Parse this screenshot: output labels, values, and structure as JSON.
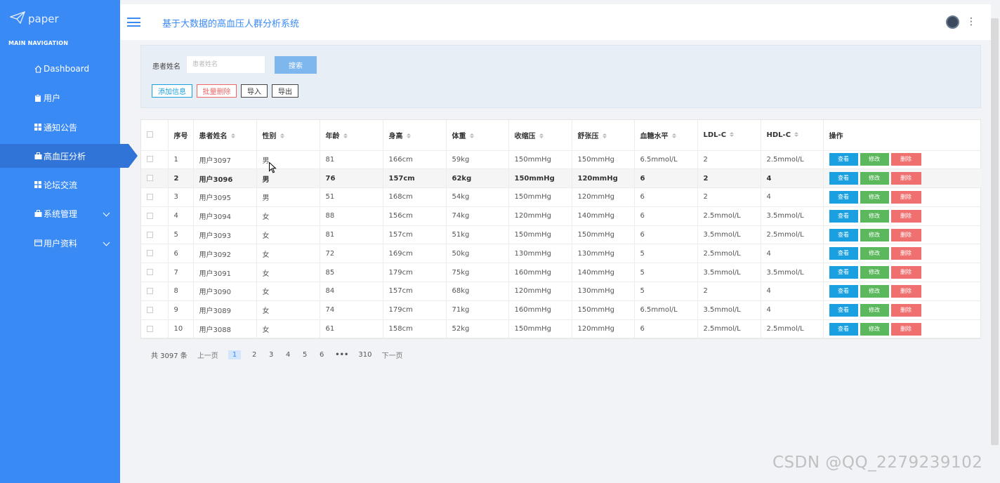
{
  "sidebar": {
    "logo_text": "paper",
    "nav_title": "MAIN NAVIGATION",
    "items": [
      {
        "label": "Dashboard",
        "icon": "home-icon"
      },
      {
        "label": "用户",
        "icon": "clipboard-icon"
      },
      {
        "label": "通知公告",
        "icon": "grid-icon"
      },
      {
        "label": "高血压分析",
        "icon": "briefcase-icon",
        "active": true
      },
      {
        "label": "论坛交流",
        "icon": "grid-icon"
      },
      {
        "label": "系统管理",
        "icon": "briefcase-icon",
        "expandable": true
      },
      {
        "label": "用户资料",
        "icon": "card-icon",
        "expandable": true
      }
    ]
  },
  "header": {
    "title": "基于大数据的高血压人群分析系统"
  },
  "search": {
    "label": "患者姓名",
    "placeholder": "患者姓名",
    "button": "搜索"
  },
  "toolbar": {
    "add": "添加信息",
    "batch_delete": "批量删除",
    "import": "导入",
    "export": "导出"
  },
  "table": {
    "columns": [
      "序号",
      "患者姓名",
      "性别",
      "年龄",
      "身高",
      "体重",
      "收缩压",
      "舒张压",
      "血糖水平",
      "LDL-C",
      "HDL-C",
      "操作"
    ],
    "actions": {
      "view": "查看",
      "edit": "修改",
      "delete": "删除"
    },
    "rows": [
      [
        "1",
        "用户3097",
        "男",
        "81",
        "166cm",
        "59kg",
        "150mmHg",
        "150mmHg",
        "6.5mmol/L",
        "2",
        "2.5mmol/L"
      ],
      [
        "2",
        "用户3096",
        "男",
        "76",
        "157cm",
        "62kg",
        "150mmHg",
        "120mmHg",
        "6",
        "2",
        "4"
      ],
      [
        "3",
        "用户3095",
        "男",
        "51",
        "168cm",
        "54kg",
        "150mmHg",
        "120mmHg",
        "6",
        "2",
        "4"
      ],
      [
        "4",
        "用户3094",
        "女",
        "88",
        "156cm",
        "74kg",
        "120mmHg",
        "140mmHg",
        "6",
        "2.5mmol/L",
        "3.5mmol/L"
      ],
      [
        "5",
        "用户3093",
        "女",
        "81",
        "157cm",
        "51kg",
        "150mmHg",
        "150mmHg",
        "6",
        "3.5mmol/L",
        "2.5mmol/L"
      ],
      [
        "6",
        "用户3092",
        "女",
        "72",
        "169cm",
        "50kg",
        "130mmHg",
        "130mmHg",
        "5",
        "2.5mmol/L",
        "4"
      ],
      [
        "7",
        "用户3091",
        "女",
        "85",
        "179cm",
        "75kg",
        "160mmHg",
        "140mmHg",
        "5",
        "3.5mmol/L",
        "3.5mmol/L"
      ],
      [
        "8",
        "用户3090",
        "女",
        "84",
        "157cm",
        "68kg",
        "120mmHg",
        "130mmHg",
        "5",
        "2",
        "4"
      ],
      [
        "9",
        "用户3089",
        "女",
        "74",
        "179cm",
        "71kg",
        "160mmHg",
        "150mmHg",
        "6.5mmol/L",
        "3.5mmol/L",
        "4"
      ],
      [
        "10",
        "用户3088",
        "女",
        "61",
        "158cm",
        "52kg",
        "150mmHg",
        "120mmHg",
        "6",
        "2.5mmol/L",
        "2.5mmol/L"
      ]
    ],
    "highlighted_row": 2
  },
  "pagination": {
    "total": "共 3097 条",
    "prev": "上一页",
    "next": "下一页",
    "pages": [
      "1",
      "2",
      "3",
      "4",
      "5",
      "6",
      "•••",
      "310"
    ],
    "current": "1"
  },
  "watermark": "CSDN @QQ_2279239102",
  "colors": {
    "sidebar": "#3a8af6",
    "sidebar_active": "#2f74d6",
    "view_button": "#1aa0e0",
    "edit_button": "#5cb85c",
    "delete_button": "#f07070"
  }
}
